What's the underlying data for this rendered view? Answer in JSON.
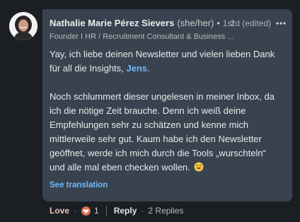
{
  "comment": {
    "author": {
      "name": "Nathalie Marie Pérez Sievers",
      "pronouns": "(she/her)",
      "degree": "1st",
      "headline": "Founder I HR / Recruitment Consultant & Business ..."
    },
    "timestamp": "2d (edited)",
    "text": {
      "para1_before": "Yay, ich liebe deinen Newsletter und vielen lieben Dank für all die Insights, ",
      "mention": "Jens",
      "para1_after": ".",
      "para2": "Noch schlummert dieser ungelesen in meiner Inbox, da ich die nötige Zeit brauche. Denn ich weiß deine Empfehlungen sehr zu schätzen und kenne mich mittlerweile sehr gut. Kaum habe ich den Newsletter geöffnet, werde ich mich durch die Tools „wurschteln“ und alle mal eben checken wollen."
    },
    "see_translation": "See translation",
    "actions": {
      "like_label": "Love",
      "reaction_count": "1",
      "reply_label": "Reply",
      "replies_label": "2 Replies"
    }
  },
  "icons": {
    "more": "ellipsis-icon",
    "reaction": "love-reaction-icon",
    "emoji": "sweat-smile-emoji"
  },
  "colors": {
    "page_bg": "#1b1f23",
    "bubble_bg": "#38434f",
    "link_blue": "#71b7fb",
    "love_red": "#df704d"
  }
}
